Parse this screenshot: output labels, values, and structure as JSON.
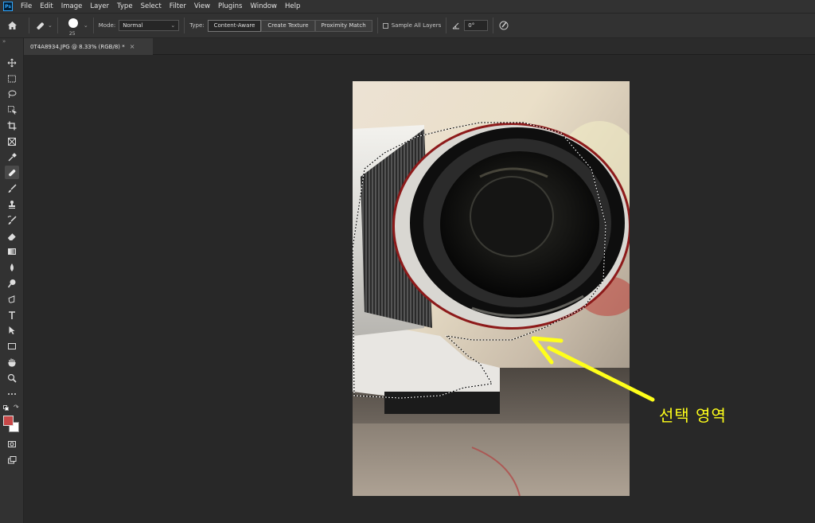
{
  "app": {
    "logo": "Ps"
  },
  "menu": [
    "File",
    "Edit",
    "Image",
    "Layer",
    "Type",
    "Select",
    "Filter",
    "View",
    "Plugins",
    "Window",
    "Help"
  ],
  "options": {
    "brush_size": "25",
    "mode_label": "Mode:",
    "mode_value": "Normal",
    "type_label": "Type:",
    "type_buttons": [
      "Content-Aware",
      "Create Texture",
      "Proximity Match"
    ],
    "sample_all_layers": "Sample All Layers",
    "angle_value": "0°"
  },
  "document": {
    "tab_title": "0T4A8934.JPG @ 8.33% (RGB/8) *",
    "close_glyph": "×"
  },
  "annotation": {
    "text": "선택 영역",
    "color": "#ffff1a"
  },
  "colors": {
    "foreground": "#c84848",
    "background": "#ffffff"
  },
  "tools": [
    "move-tool",
    "marquee-tool",
    "lasso-tool",
    "object-selection-tool",
    "crop-tool",
    "frame-tool",
    "eyedropper-tool",
    "spot-healing-brush-tool",
    "brush-tool",
    "clone-stamp-tool",
    "history-brush-tool",
    "eraser-tool",
    "gradient-tool",
    "blur-tool",
    "dodge-tool",
    "pen-tool",
    "type-tool",
    "path-selection-tool",
    "rectangle-tool",
    "hand-tool",
    "zoom-tool",
    "more-tools"
  ]
}
